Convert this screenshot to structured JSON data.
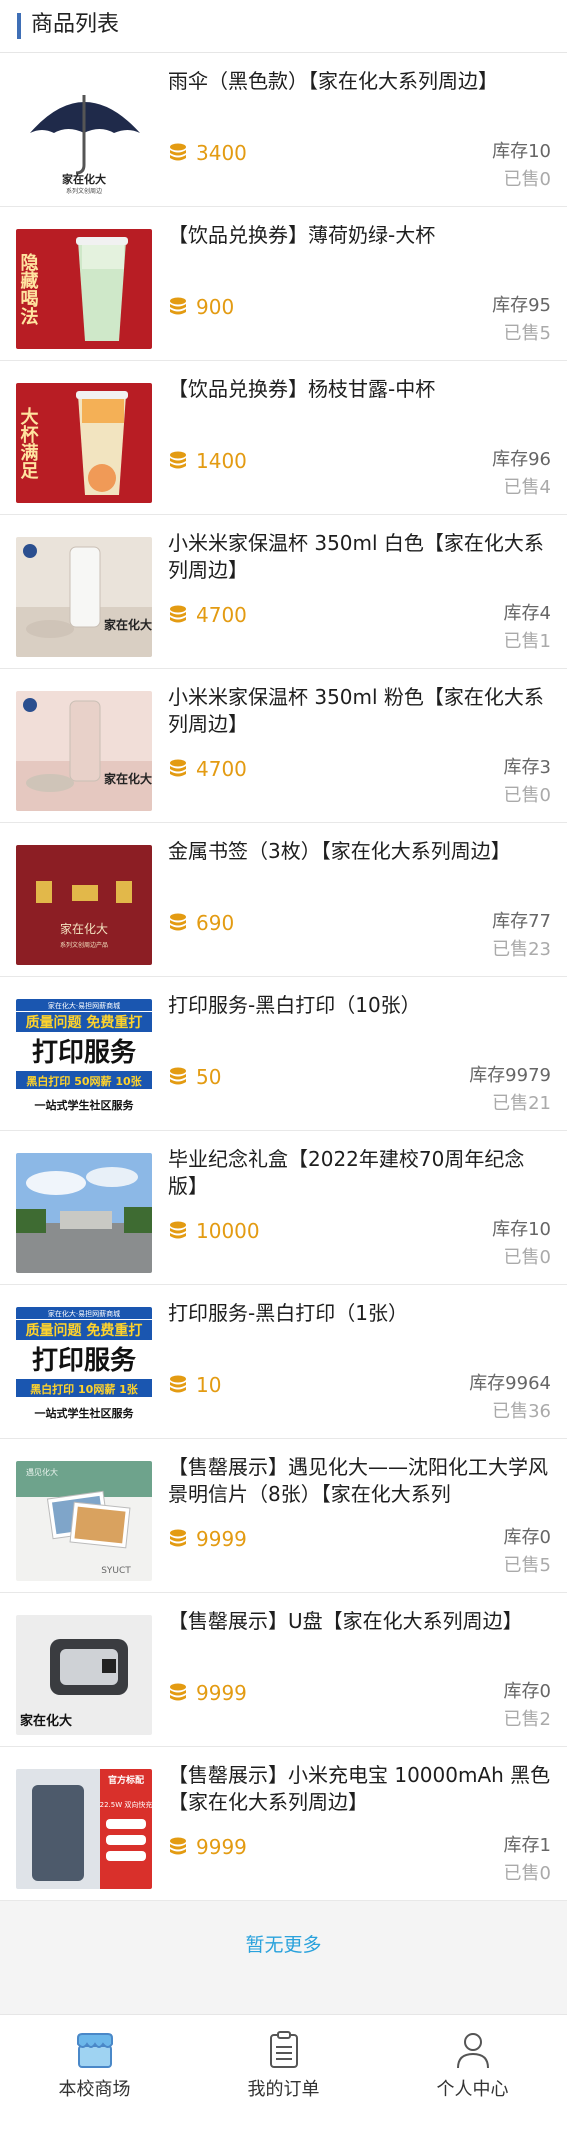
{
  "header": {
    "title": "商品列表"
  },
  "products": [
    {
      "name": "雨伞（黑色款）【家在化大系列周边】",
      "price": "3400",
      "stock": "库存10",
      "sold": "已售0",
      "image": "umbrella",
      "image_text": "家在化大",
      "image_subtext": "系列文创周边"
    },
    {
      "name": "【饮品兑换券】薄荷奶绿-大杯",
      "price": "900",
      "stock": "库存95",
      "sold": "已售5",
      "image": "tea-green",
      "image_text": "隐藏喝法"
    },
    {
      "name": "【饮品兑换券】杨枝甘露-中杯",
      "price": "1400",
      "stock": "库存96",
      "sold": "已售4",
      "image": "tea-orange",
      "image_text": "大杯满足"
    },
    {
      "name": "小米米家保温杯 350ml 白色【家在化大系列周边】",
      "price": "4700",
      "stock": "库存4",
      "sold": "已售1",
      "image": "cup-white",
      "image_text": "家在化大"
    },
    {
      "name": "小米米家保温杯 350ml 粉色【家在化大系列周边】",
      "price": "4700",
      "stock": "库存3",
      "sold": "已售0",
      "image": "cup-pink",
      "image_text": "家在化大"
    },
    {
      "name": "金属书签（3枚）【家在化大系列周边】",
      "price": "690",
      "stock": "库存77",
      "sold": "已售23",
      "image": "bookmark",
      "image_text": "家在化大",
      "image_subtext": "系列文创周边产品"
    },
    {
      "name": "打印服务-黑白打印（10张）",
      "price": "50",
      "stock": "库存9979",
      "sold": "已售21",
      "image": "print-10",
      "image_top": "家在化大·易担网薪商城",
      "image_line1": "质量问题 免费重打",
      "image_line2": "打印服务",
      "image_line3": "黑白打印 50网薪 10张",
      "image_line4": "一站式学生社区服务"
    },
    {
      "name": "毕业纪念礼盒【2022年建校70周年纪念版】",
      "price": "10000",
      "stock": "库存10",
      "sold": "已售0",
      "image": "campus"
    },
    {
      "name": "打印服务-黑白打印（1张）",
      "price": "10",
      "stock": "库存9964",
      "sold": "已售36",
      "image": "print-1",
      "image_top": "家在化大·易担网薪商城",
      "image_line1": "质量问题 免费重打",
      "image_line2": "打印服务",
      "image_line3": "黑白打印 10网薪 1张",
      "image_line4": "一站式学生社区服务"
    },
    {
      "name": "【售罄展示】遇见化大——沈阳化工大学风景明信片（8张）【家在化大系列",
      "price": "9999",
      "stock": "库存0",
      "sold": "已售5",
      "image": "postcard",
      "image_text": "遇见化大",
      "image_subtext": "SYUCT"
    },
    {
      "name": "【售罄展示】U盘【家在化大系列周边】",
      "price": "9999",
      "stock": "库存0",
      "sold": "已售2",
      "image": "usb",
      "image_text": "家在化大"
    },
    {
      "name": "【售罄展示】小米充电宝 10000mAh 黑色【家在化大系列周边】",
      "price": "9999",
      "stock": "库存1",
      "sold": "已售0",
      "image": "powerbank",
      "image_text": "官方标配",
      "image_subtext": "22.5W 双向快充"
    }
  ],
  "footer": {
    "no_more": "暂无更多"
  },
  "tabbar": {
    "items": [
      {
        "label": "本校商场",
        "icon": "shop-icon",
        "active": true
      },
      {
        "label": "我的订单",
        "icon": "clipboard-icon",
        "active": false
      },
      {
        "label": "个人中心",
        "icon": "user-icon",
        "active": false
      }
    ]
  },
  "colors": {
    "accent": "#3f6fb6",
    "price": "#e39b12",
    "link": "#2aa2dc"
  }
}
